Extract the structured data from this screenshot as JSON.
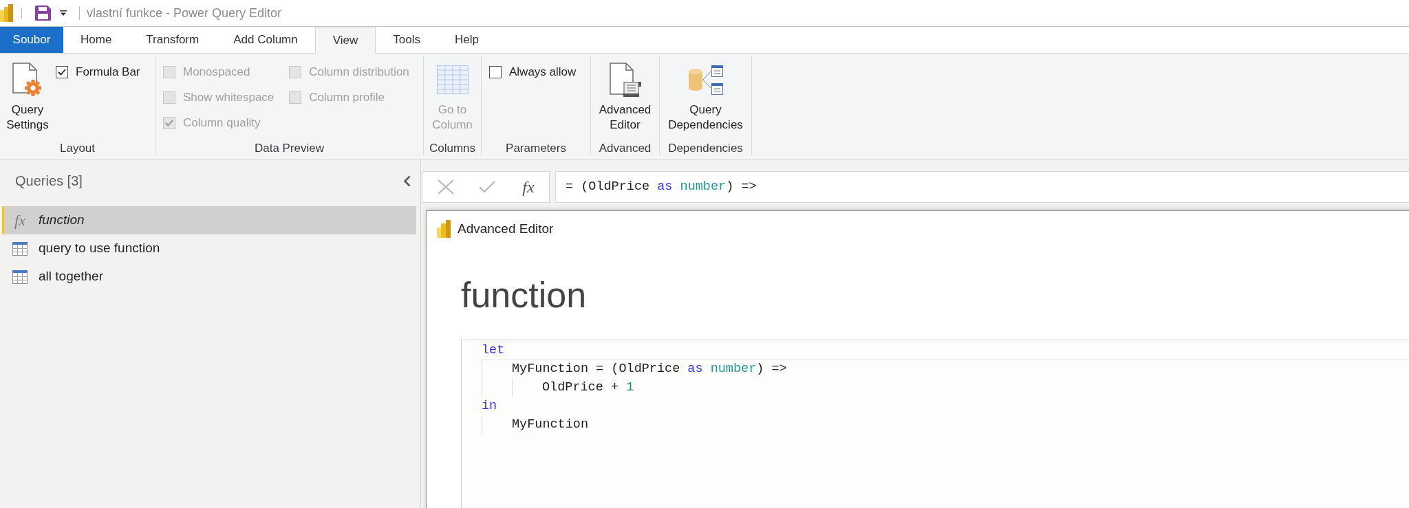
{
  "title_bar": {
    "title": "vlastní funkce - Power Query Editor"
  },
  "ribbon_tabs": [
    {
      "label": "Soubor",
      "kind": "file",
      "selected": false
    },
    {
      "label": "Home",
      "kind": "tab",
      "selected": false
    },
    {
      "label": "Transform",
      "kind": "tab",
      "selected": false
    },
    {
      "label": "Add Column",
      "kind": "tab",
      "selected": false
    },
    {
      "label": "View",
      "kind": "tab",
      "selected": true
    },
    {
      "label": "Tools",
      "kind": "tab",
      "selected": false
    },
    {
      "label": "Help",
      "kind": "tab",
      "selected": false
    }
  ],
  "ribbon_groups": [
    {
      "label": "Layout",
      "controls": [
        {
          "kind": "large_button",
          "label": "Query Settings",
          "disabled": false
        },
        {
          "kind": "checkbox_column",
          "items": [
            {
              "label": "Formula Bar",
              "checked": true,
              "disabled": false
            }
          ]
        }
      ]
    },
    {
      "label": "Data Preview",
      "controls": [
        {
          "kind": "checkbox_column",
          "items": [
            {
              "label": "Monospaced",
              "checked": false,
              "disabled": true
            },
            {
              "label": "Show whitespace",
              "checked": false,
              "disabled": true
            },
            {
              "label": "Column quality",
              "checked": true,
              "disabled": true
            }
          ]
        },
        {
          "kind": "checkbox_column",
          "items": [
            {
              "label": "Column distribution",
              "checked": false,
              "disabled": true
            },
            {
              "label": "Column profile",
              "checked": false,
              "disabled": true
            }
          ]
        }
      ]
    },
    {
      "label": "Columns",
      "controls": [
        {
          "kind": "large_button",
          "label": "Go to Column",
          "disabled": true
        }
      ]
    },
    {
      "label": "Parameters",
      "controls": [
        {
          "kind": "checkbox_column",
          "items": [
            {
              "label": "Always allow",
              "checked": false,
              "disabled": false
            }
          ]
        }
      ]
    },
    {
      "label": "Advanced",
      "controls": [
        {
          "kind": "large_button",
          "label": "Advanced Editor",
          "disabled": false
        }
      ]
    },
    {
      "label": "Dependencies",
      "controls": [
        {
          "kind": "large_button",
          "label": "Query Dependencies",
          "disabled": false
        }
      ]
    }
  ],
  "queries_panel": {
    "title": "Queries [3]",
    "items": [
      {
        "label": "function",
        "kind": "function",
        "glyph": "fx",
        "selected": true
      },
      {
        "label": "query to use function",
        "kind": "table",
        "selected": false
      },
      {
        "label": "all together",
        "kind": "table",
        "selected": false
      }
    ]
  },
  "formula_bar": {
    "buttons": [
      {
        "kind": "cancel",
        "disabled": true
      },
      {
        "kind": "commit",
        "disabled": true
      },
      {
        "kind": "insert_function",
        "label": "fx",
        "disabled": false
      }
    ],
    "formula": [
      {
        "text": "= (OldPrice ",
        "kind": "plain"
      },
      {
        "text": "as",
        "kind": "keyword"
      },
      {
        "text": " number",
        "kind": "type"
      },
      {
        "text": ") =>",
        "kind": "plain"
      }
    ]
  },
  "advanced_editor": {
    "title": "Advanced Editor",
    "query_name": "function",
    "code": [
      {
        "tokens": [
          {
            "text": "let",
            "kind": "keyword"
          }
        ],
        "current": true,
        "children": [
          {
            "tokens": [
              {
                "text": "MyFunction = (OldPrice ",
                "kind": "plain"
              },
              {
                "text": "as",
                "kind": "keyword"
              },
              {
                "text": " number",
                "kind": "type"
              },
              {
                "text": ") =>",
                "kind": "plain"
              }
            ],
            "current": false,
            "children": [
              {
                "tokens": [
                  {
                    "text": "OldPrice + ",
                    "kind": "plain"
                  },
                  {
                    "text": "1",
                    "kind": "number"
                  }
                ],
                "current": false
              }
            ]
          }
        ]
      },
      {
        "tokens": [
          {
            "text": "in",
            "kind": "keyword"
          }
        ],
        "current": false,
        "children": [
          {
            "tokens": [
              {
                "text": "MyFunction",
                "kind": "plain"
              }
            ],
            "current": false
          }
        ]
      }
    ]
  }
}
